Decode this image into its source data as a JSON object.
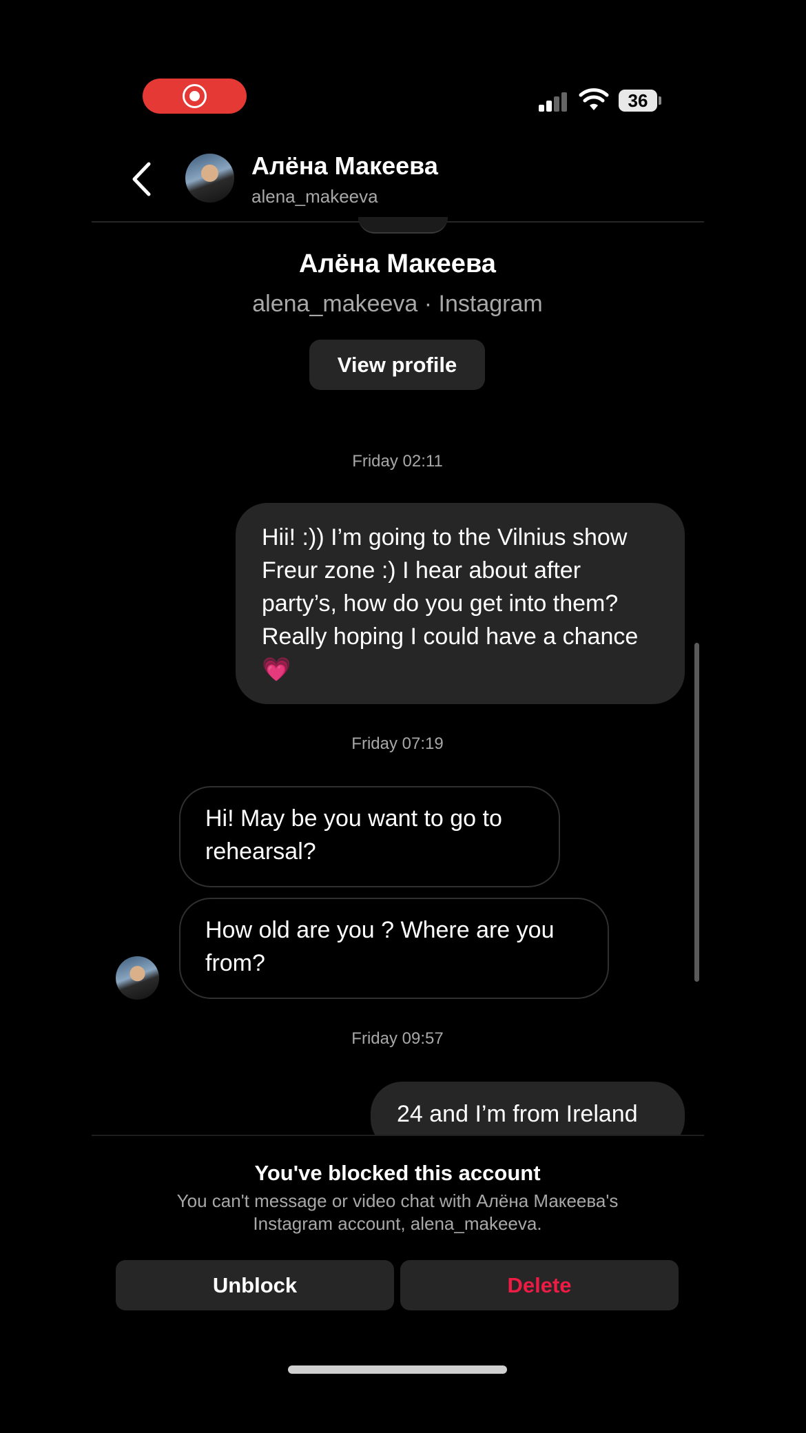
{
  "status_bar": {
    "battery": "36"
  },
  "header": {
    "name": "Алёна Макеева",
    "username": "alena_makeeva"
  },
  "profile_card": {
    "name": "Алёна Макеева",
    "subtitle": "alena_makeeva · Instagram",
    "view_profile_label": "View profile"
  },
  "messages": [
    {
      "timestamp": "Friday 02:11"
    },
    {
      "direction": "outgoing",
      "text": "Hii! :)) I’m going to the Vilnius show  Freur zone :) I hear about after party’s, how do you get into them? Really hoping I could have a chance 💗"
    },
    {
      "timestamp": "Friday 07:19"
    },
    {
      "direction": "incoming",
      "text": "Hi! May be you want to go to rehearsal?"
    },
    {
      "direction": "incoming",
      "text": "How old are you ? Where are you from?"
    },
    {
      "timestamp": "Friday 09:57"
    },
    {
      "direction": "outgoing",
      "text": "24 and I’m from Ireland"
    }
  ],
  "blocked_notice": {
    "title": "You've blocked this account",
    "description": "You can't message or video chat with Алёна Макеева's Instagram account, alena_makeeva."
  },
  "actions": {
    "unblock_label": "Unblock",
    "delete_label": "Delete"
  },
  "colors": {
    "background": "#000000",
    "bubble": "#262626",
    "record_indicator": "#e53935",
    "delete": "#ed1c45",
    "secondary_text": "#a8a8a8"
  }
}
